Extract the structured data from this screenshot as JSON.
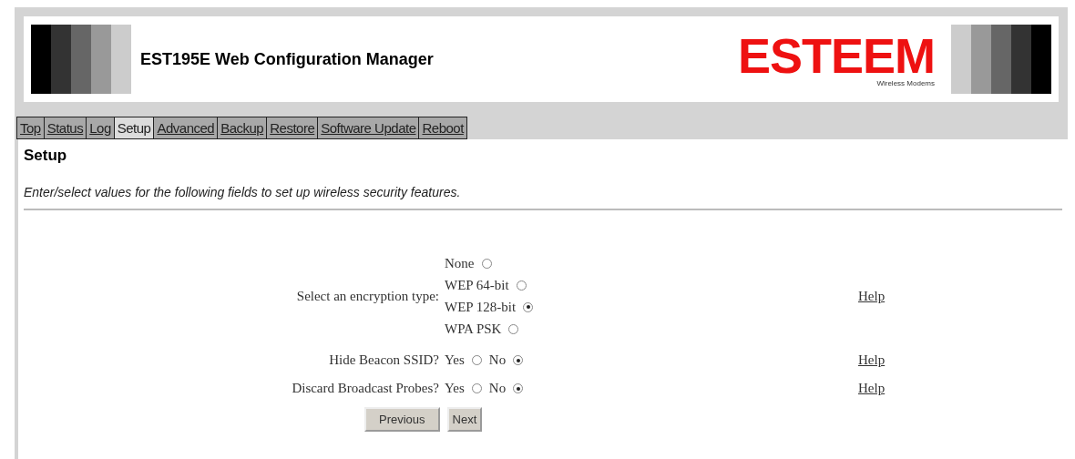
{
  "header": {
    "title": "EST195E Web Configuration Manager",
    "logo": {
      "name": "ESTEEM",
      "tagline": "Wireless Modems"
    }
  },
  "tabs": [
    {
      "label": "Top",
      "selected": false
    },
    {
      "label": "Status",
      "selected": false
    },
    {
      "label": "Log",
      "selected": false
    },
    {
      "label": "Setup",
      "selected": true
    },
    {
      "label": "Advanced",
      "selected": false
    },
    {
      "label": "Backup",
      "selected": false
    },
    {
      "label": "Restore",
      "selected": false
    },
    {
      "label": "Software Update",
      "selected": false
    },
    {
      "label": "Reboot",
      "selected": false
    }
  ],
  "section": {
    "title": "Setup",
    "description": "Enter/select values for the following fields to set up wireless security features."
  },
  "settings": [
    {
      "label": "Select an encryption type:",
      "kind": "stacked",
      "help": "Help",
      "options": [
        {
          "label": "None",
          "selected": false
        },
        {
          "label": "WEP 64-bit",
          "selected": false
        },
        {
          "label": "WEP 128-bit",
          "selected": true
        },
        {
          "label": "WPA PSK",
          "selected": false
        }
      ]
    },
    {
      "label": "Hide Beacon SSID?",
      "kind": "inline",
      "help": "Help",
      "options": [
        {
          "label": "Yes",
          "selected": false
        },
        {
          "label": "No",
          "selected": true
        }
      ]
    },
    {
      "label": "Discard Broadcast Probes?",
      "kind": "inline",
      "help": "Help",
      "options": [
        {
          "label": "Yes",
          "selected": false
        },
        {
          "label": "No",
          "selected": true
        }
      ]
    }
  ],
  "buttons": [
    "Previous",
    "Next"
  ]
}
